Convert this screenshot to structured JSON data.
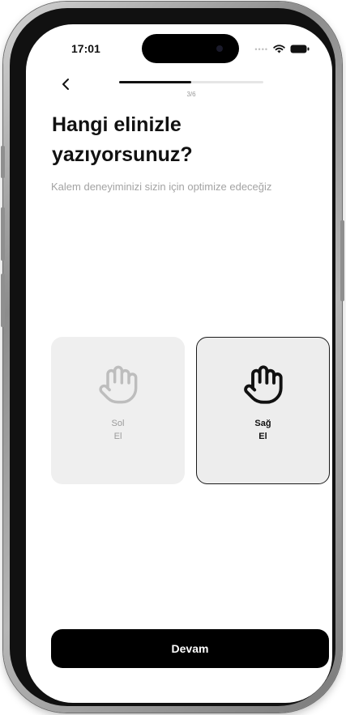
{
  "status_bar": {
    "time": "17:01"
  },
  "onboarding": {
    "step": "3/6",
    "progress": 0.5,
    "title": "Hangi elinizle yazıyorsunuz?",
    "subtitle": "Kalem deneyiminizi sizin için optimize edeceğiz"
  },
  "options": [
    {
      "line1": "Sol",
      "line2": "El",
      "selected": false,
      "icon": "hand-icon"
    },
    {
      "line1": "Sağ",
      "line2": "El",
      "selected": true,
      "icon": "hand-icon"
    }
  ],
  "actions": {
    "continue_label": "Devam"
  },
  "colors": {
    "accent": "#000000",
    "card_bg": "#EFEFEF",
    "muted_text": "#A3A3A3"
  }
}
